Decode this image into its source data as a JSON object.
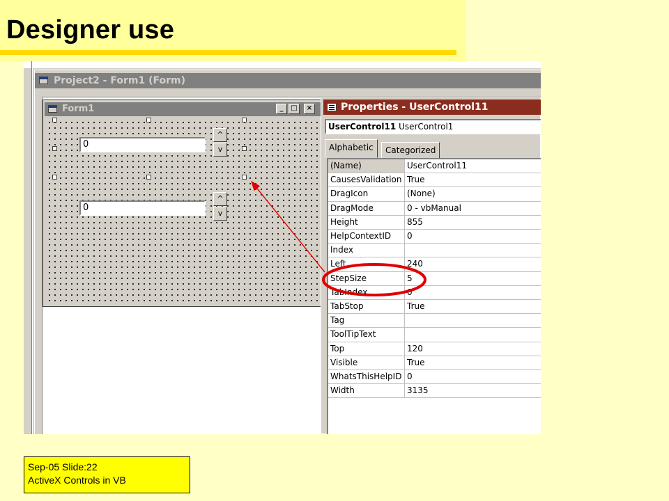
{
  "slide": {
    "title": "Designer use",
    "footer_line1": "Sep-05 Slide:22",
    "footer_line2": "ActiveX Controls in VB"
  },
  "project_window": {
    "title": "Project2 - Form1 (Form)"
  },
  "form1": {
    "title": "Form1",
    "caption_buttons": [
      "_",
      "□",
      "×"
    ],
    "controls": [
      {
        "text": "0",
        "spin_up": "^",
        "spin_down": "v",
        "selected": true
      },
      {
        "text": "0",
        "spin_up": "^",
        "spin_down": "v",
        "selected": false
      }
    ]
  },
  "properties_window": {
    "title": "Properties - UserControl11",
    "object_name": "UserControl11",
    "object_type": "UserControl1",
    "tabs": [
      "Alphabetic",
      "Categorized"
    ],
    "active_tab": "Alphabetic",
    "rows": [
      {
        "name": "(Name)",
        "value": "UserControl11"
      },
      {
        "name": "CausesValidation",
        "value": "True"
      },
      {
        "name": "DragIcon",
        "value": "(None)"
      },
      {
        "name": "DragMode",
        "value": "0 - vbManual"
      },
      {
        "name": "Height",
        "value": "855"
      },
      {
        "name": "HelpContextID",
        "value": "0"
      },
      {
        "name": "Index",
        "value": ""
      },
      {
        "name": "Left",
        "value": "240"
      },
      {
        "name": "StepSize",
        "value": "5"
      },
      {
        "name": "TabIndex",
        "value": "0"
      },
      {
        "name": "TabStop",
        "value": "True"
      },
      {
        "name": "Tag",
        "value": ""
      },
      {
        "name": "ToolTipText",
        "value": ""
      },
      {
        "name": "Top",
        "value": "120"
      },
      {
        "name": "Visible",
        "value": "True"
      },
      {
        "name": "WhatsThisHelpID",
        "value": "0"
      },
      {
        "name": "Width",
        "value": "3135"
      }
    ]
  },
  "annotation": {
    "highlighted_property": "StepSize",
    "ellipse_color": "#e00000",
    "arrow_color": "#e00000"
  },
  "colors": {
    "slide_background": "#ffffc6",
    "title_band": "#ffff9c",
    "title_rule": "#ffd900",
    "footer_box": "#ffff00",
    "properties_titlebar": "#8b2d1e",
    "inactive_titlebar": "#808080"
  }
}
